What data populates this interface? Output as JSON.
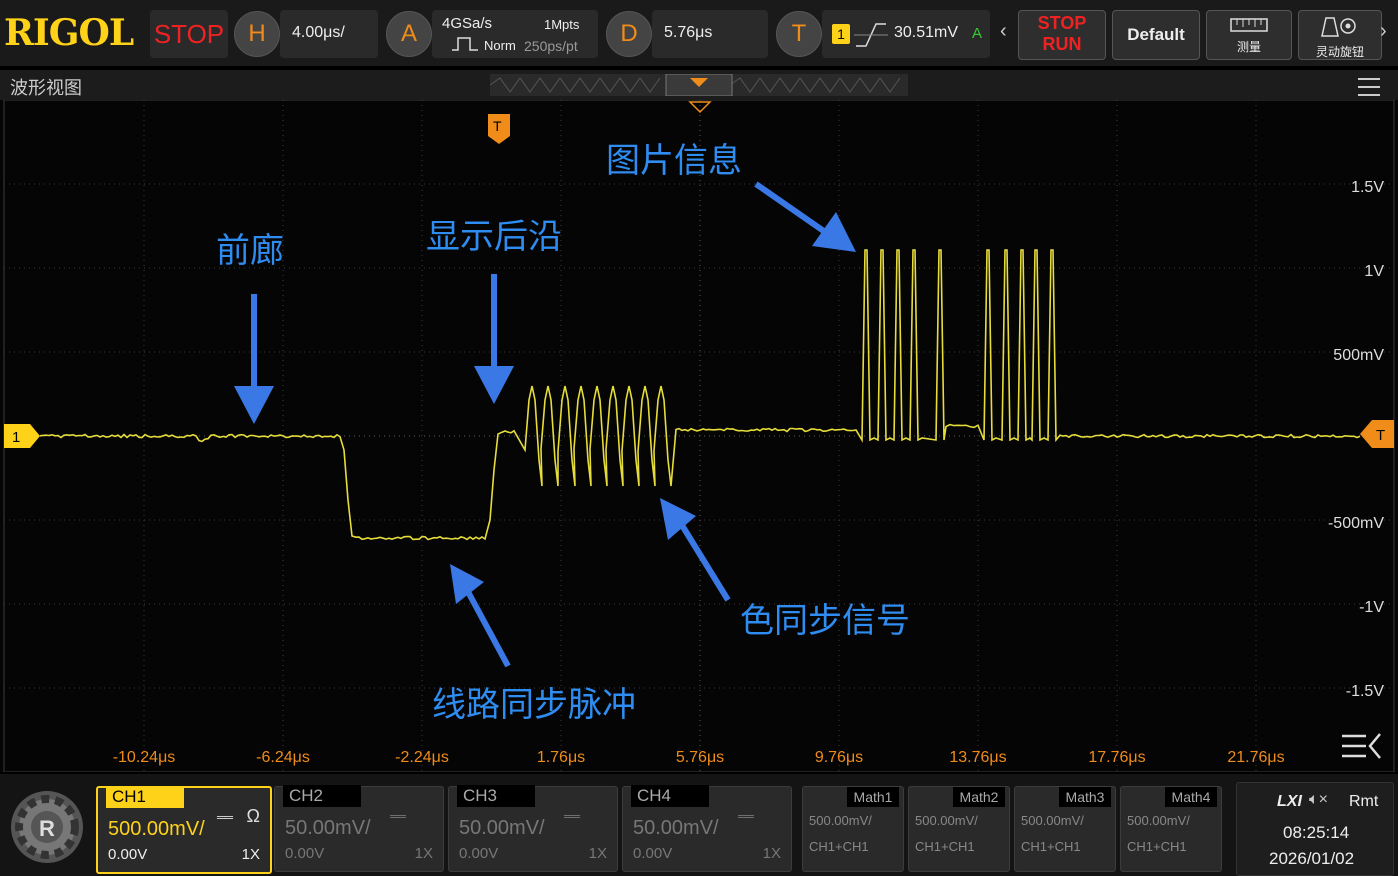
{
  "topbar": {
    "logo": "RIGOL",
    "run_state": "STOP",
    "horizontal": {
      "key": "H",
      "scale": "4.00μs/"
    },
    "acquire": {
      "key": "A",
      "sample_rate": "4GSa/s",
      "memory": "1Mpts",
      "mode": "Norm",
      "resolution": "250ps/pt"
    },
    "delay": {
      "key": "D",
      "value": "5.76μs"
    },
    "trigger": {
      "key": "T",
      "source": "1",
      "level": "30.51mV",
      "mode": "A"
    },
    "stop_run_top": "STOP",
    "stop_run_bottom": "RUN",
    "default_label": "Default",
    "measure_label": "测量",
    "knob_label": "灵动旋钮"
  },
  "view": {
    "title": "波形视图"
  },
  "screen": {
    "ch1_marker": "1",
    "trigger_marker": "T",
    "trigger_level_marker": "T",
    "volt_labels": [
      "1.5V",
      "1V",
      "500mV",
      "-500mV",
      "-1V",
      "-1.5V"
    ],
    "time_labels": [
      "-10.24μs",
      "-6.24μs",
      "-2.24μs",
      "1.76μs",
      "5.76μs",
      "9.76μs",
      "13.76μs",
      "17.76μs",
      "21.76μs"
    ],
    "annotations": {
      "front_porch": "前廊",
      "back_porch": "显示后沿",
      "image_info": "图片信息",
      "color_sync": "色同步信号",
      "line_sync": "线路同步脉冲"
    }
  },
  "channels": [
    {
      "name": "CH1",
      "scale": "500.00mV/",
      "offset": "0.00V",
      "probe": "1X",
      "active": true
    },
    {
      "name": "CH2",
      "scale": "50.00mV/",
      "offset": "0.00V",
      "probe": "1X",
      "active": false
    },
    {
      "name": "CH3",
      "scale": "50.00mV/",
      "offset": "0.00V",
      "probe": "1X",
      "active": false
    },
    {
      "name": "CH4",
      "scale": "50.00mV/",
      "offset": "0.00V",
      "probe": "1X",
      "active": false
    }
  ],
  "maths": [
    {
      "name": "Math1",
      "scale": "500.00mV/",
      "source": "CH1+CH1"
    },
    {
      "name": "Math2",
      "scale": "500.00mV/",
      "source": "CH1+CH1"
    },
    {
      "name": "Math3",
      "scale": "500.00mV/",
      "source": "CH1+CH1"
    },
    {
      "name": "Math4",
      "scale": "500.00mV/",
      "source": "CH1+CH1"
    }
  ],
  "status": {
    "lxi": "LXI",
    "remote": "Rmt",
    "time": "08:25:14",
    "date": "2026/01/02"
  },
  "colors": {
    "trace": "#e6dc3c",
    "annotation": "#2f8cf0",
    "arrow": "#3a78e6",
    "accent": "#f08c1a",
    "stop_red": "#e22222"
  }
}
